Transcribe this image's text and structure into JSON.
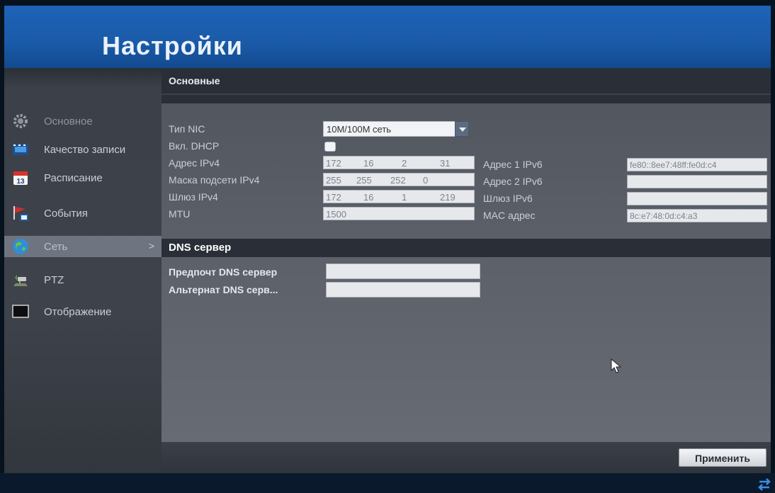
{
  "app": {
    "title": "Настройки"
  },
  "sidebar": {
    "items": [
      {
        "label": "Основное",
        "icon": "gear-icon",
        "state": "dim"
      },
      {
        "label": "Качество записи",
        "icon": "film-icon",
        "state": "normal"
      },
      {
        "label": "Расписание",
        "icon": "calendar-icon",
        "icon_text": "13",
        "state": "normal"
      },
      {
        "label": "События",
        "icon": "event-flag-icon",
        "state": "normal"
      },
      {
        "label": "Сеть",
        "icon": "globe-icon",
        "state": "active",
        "arrow": ">"
      },
      {
        "label": "PTZ",
        "icon": "ptz-camera-icon",
        "state": "normal"
      },
      {
        "label": "Отображение",
        "icon": "monitor-icon",
        "state": "normal"
      }
    ]
  },
  "main": {
    "tab": "Основные",
    "general": {
      "nic_type_label": "Тип NIC",
      "nic_type_value": "10M/100M сеть",
      "dhcp_label": "Вкл. DHCP",
      "dhcp_checked": false,
      "ipv4_label": "Адрес IPv4",
      "ipv4": [
        "172",
        "16",
        "2",
        "31"
      ],
      "mask_label": "Маска подсети IPv4",
      "mask": [
        "255",
        "255",
        "252",
        "0"
      ],
      "gateway_label": "Шлюз IPv4",
      "gateway": [
        "172",
        "16",
        "1",
        "219"
      ],
      "mtu_label": "MTU",
      "mtu": "1500",
      "ipv6_1_label": "Адрес 1 IPv6",
      "ipv6_1": "fe80::8ee7:48ff:fe0d:c4",
      "ipv6_2_label": "Адрес 2 IPv6",
      "ipv6_2": "",
      "ipv6_gateway_label": "Шлюз IPv6",
      "ipv6_gateway": "",
      "mac_label": "MAC адрес",
      "mac": "8c:e7:48:0d:c4:a3"
    },
    "dns": {
      "title": "DNS сервер",
      "preferred_label": "Предпочт DNS сервер",
      "preferred_value": "",
      "alternate_label": "Альтернат DNS серв...",
      "alternate_value": ""
    },
    "apply_label": "Применить"
  },
  "colors": {
    "header_blue": "#1e63b8",
    "sidebar_active": "#6e7580",
    "band_dark": "#2a2f37"
  }
}
